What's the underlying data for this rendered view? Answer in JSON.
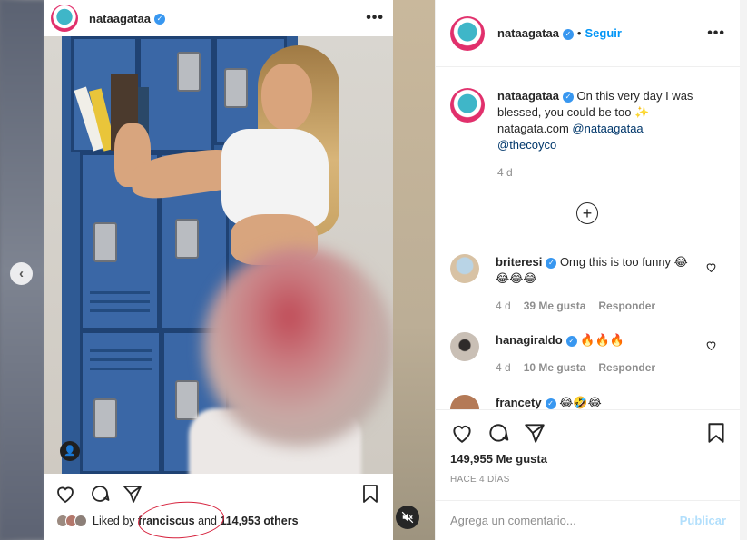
{
  "post": {
    "username": "nataagataa",
    "more_icon": "more-horizontal-icon",
    "liked_by_prefix": "Liked by",
    "liked_by_user": "franciscus",
    "liked_by_and": "and",
    "liked_by_count": "114,953 others"
  },
  "side": {
    "username": "nataagataa",
    "dot": "•",
    "follow_label": "Seguir",
    "caption": {
      "username": "nataagataa",
      "text": "On this very day I was blessed, you could be too ✨",
      "site": "natagata.com",
      "mention1": "@nataagataa",
      "mention2": "@thecoyco",
      "time": "4 d"
    },
    "comments": [
      {
        "username": "briteresi",
        "text": "Omg this is too funny 😂😂😂😂",
        "time": "4 d",
        "likes": "39 Me gusta",
        "reply": "Responder"
      },
      {
        "username": "hanagiraldo",
        "text": "🔥🔥🔥",
        "time": "4 d",
        "likes": "10 Me gusta",
        "reply": "Responder"
      },
      {
        "username": "francety",
        "text": "😂🤣😂",
        "time": "",
        "likes": "",
        "reply": ""
      }
    ],
    "likes_count": "149,955 Me gusta",
    "time_ago": "HACE 4 DÍAS",
    "comment_placeholder": "Agrega un comentario...",
    "post_button": "Publicar"
  },
  "colors": {
    "accent": "#0095f6",
    "post_disabled": "#b2dffc",
    "verified": "#3897f0",
    "annotation_circle": "#d6213c"
  }
}
